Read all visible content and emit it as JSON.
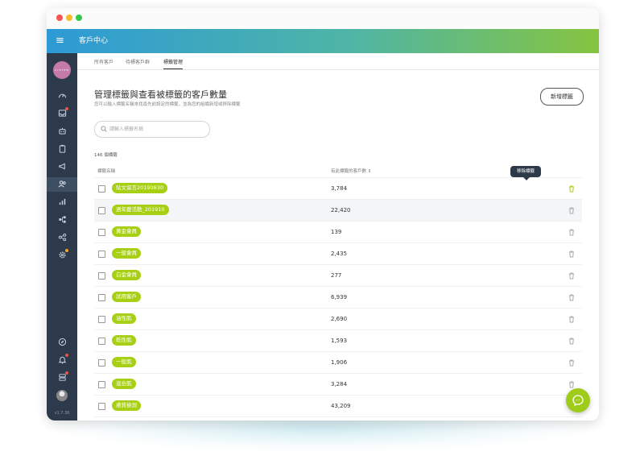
{
  "app": {
    "title": "客戶中心",
    "version": "v1.7.36"
  },
  "tabs": [
    {
      "label": "所有客戶"
    },
    {
      "label": "待標客戶群"
    },
    {
      "label": "標籤管理"
    }
  ],
  "page": {
    "title": "管理標籤與查看被標籤的客戶數量",
    "subtitle": "您可以輸入標籤名稱來找尋先前設定的標籤，並為您的組織新增或移除標籤",
    "add_button": "新增標籤",
    "search_placeholder": "請輸入標籤名稱",
    "tag_count": "146 個標籤"
  },
  "table": {
    "col_name": "標籤名稱",
    "col_count": "有此標籤的客戶數",
    "sort_icon": "sort-icon",
    "remove_tooltip": "移除標籤",
    "rows": [
      {
        "tag": "貼文留言20190830",
        "count": "3,784"
      },
      {
        "tag": "週年慶活動_201910",
        "count": "22,420"
      },
      {
        "tag": "黃金會員",
        "count": "139"
      },
      {
        "tag": "一般會員",
        "count": "2,435"
      },
      {
        "tag": "白金會員",
        "count": "277"
      },
      {
        "tag": "試用客戶",
        "count": "6,939"
      },
      {
        "tag": "油性肌",
        "count": "2,690"
      },
      {
        "tag": "乾性肌",
        "count": "1,593"
      },
      {
        "tag": "一般肌",
        "count": "1,906"
      },
      {
        "tag": "混合肌",
        "count": "3,284"
      },
      {
        "tag": "膚質檢測",
        "count": "43,209"
      }
    ]
  },
  "colors": {
    "tag_green": "#a7cf14",
    "sidebar": "#2d3a4b",
    "header_start": "#2d9ad6",
    "header_end": "#86c440"
  },
  "icons": [
    "menu-icon",
    "dashboard-icon",
    "inbox-icon",
    "bot-icon",
    "clipboard-icon",
    "megaphone-icon",
    "users-icon",
    "chart-icon",
    "flow-icon",
    "share-icon",
    "settings-icon",
    "compass-icon",
    "bell-icon",
    "server-icon",
    "trash-icon",
    "messenger-icon"
  ]
}
